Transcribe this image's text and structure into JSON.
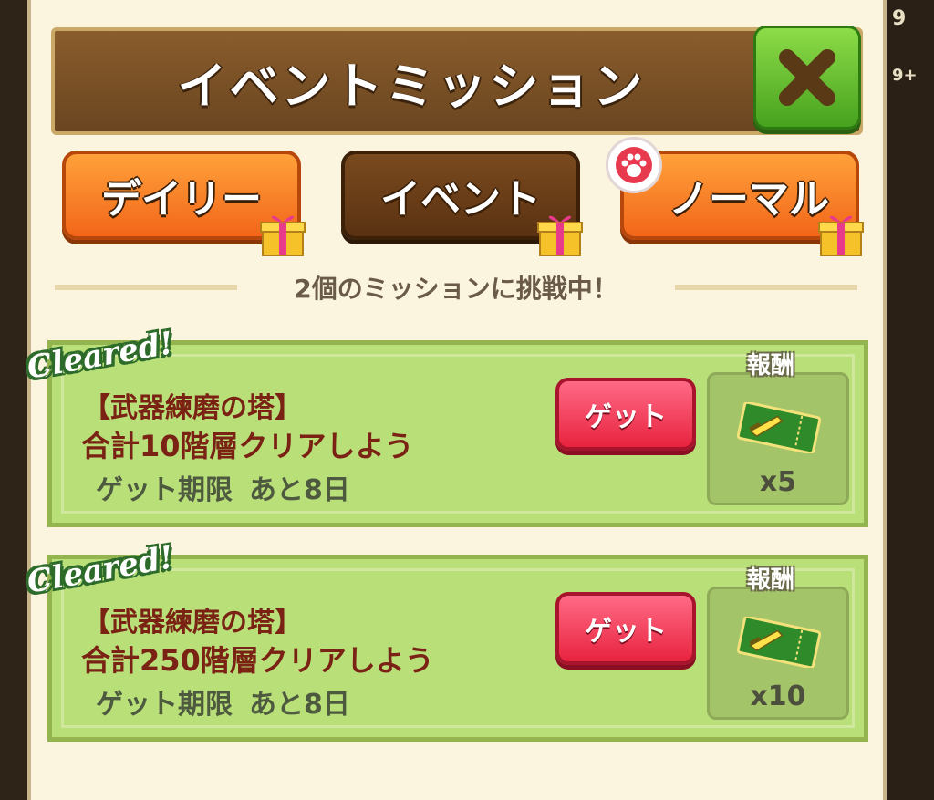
{
  "header": {
    "title": "イベントミッション"
  },
  "background": {
    "partial_right_top": "9",
    "partial_right_mid": "9+"
  },
  "tabs": [
    {
      "label": "デイリー",
      "active": false
    },
    {
      "label": "イベント",
      "active": true
    },
    {
      "label": "ノーマル",
      "active": false
    }
  ],
  "status": {
    "text": "2個のミッションに挑戦中！"
  },
  "missions": [
    {
      "badge": "Cleared!",
      "category": "【武器練磨の塔】",
      "description": "合計10階層クリアしよう",
      "deadline_label": "ゲット期限",
      "deadline_value": "あと8日",
      "button_label": "ゲット",
      "reward_label": "報酬",
      "reward_icon": "ticket-icon",
      "reward_qty": "x5"
    },
    {
      "badge": "Cleared!",
      "category": "【武器練磨の塔】",
      "description": "合計250階層クリアしよう",
      "deadline_label": "ゲット期限",
      "deadline_value": "あと8日",
      "button_label": "ゲット",
      "reward_label": "報酬",
      "reward_icon": "ticket-icon",
      "reward_qty": "x10"
    }
  ],
  "colors": {
    "header_bg": "#6a4520",
    "tab_orange": "#f2661a",
    "tab_active": "#5a3212",
    "close_green": "#47a21e",
    "card_green": "#b9df79",
    "get_red": "#e8233f"
  }
}
